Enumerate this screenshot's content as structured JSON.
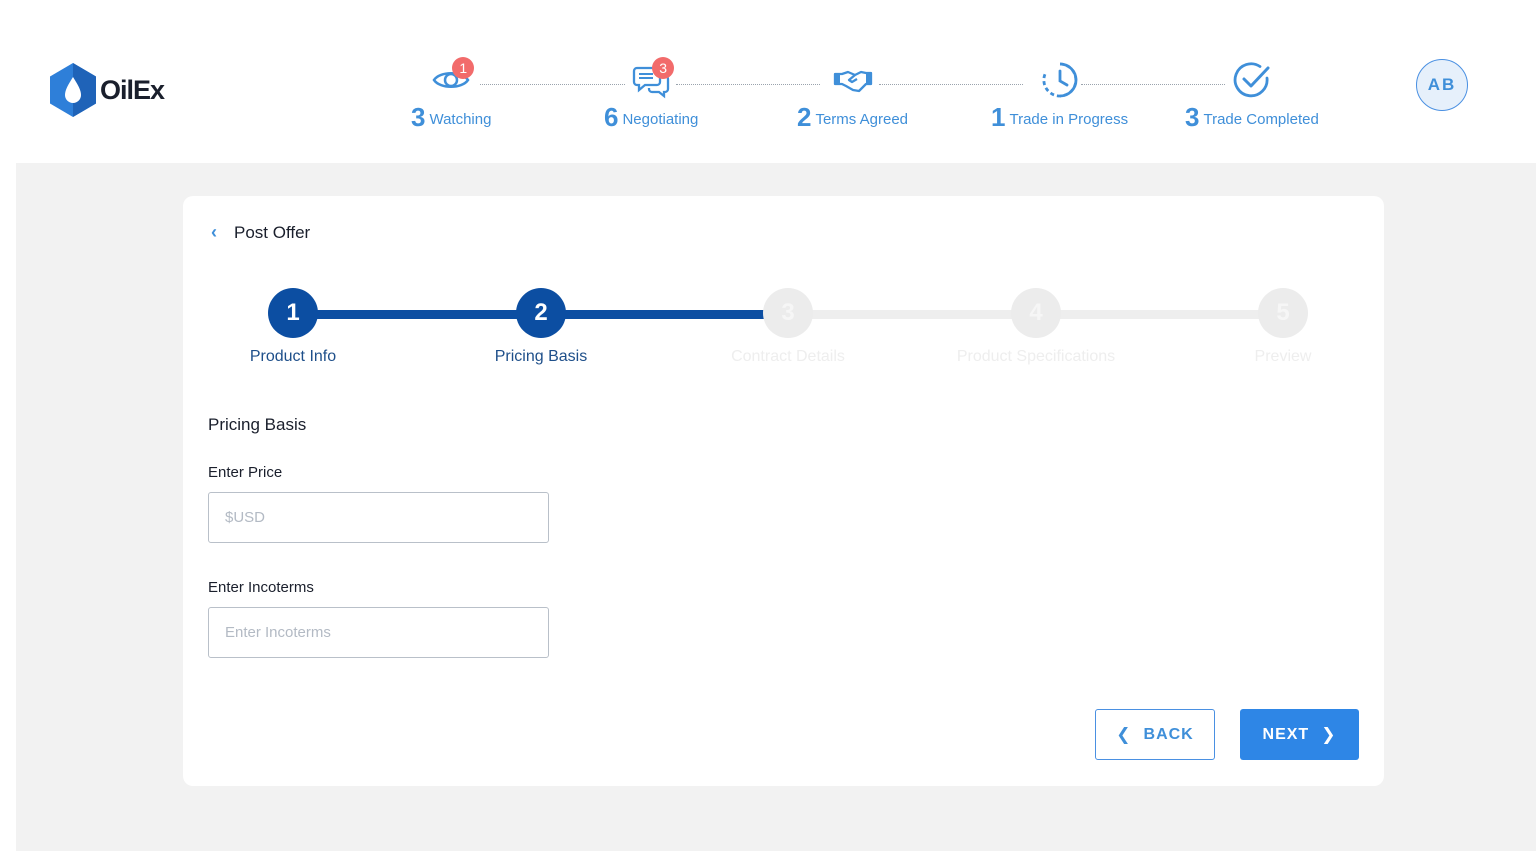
{
  "app": {
    "name": "OilEx",
    "brand_color": "#0c4ea2",
    "accent_color": "#3f8fd9"
  },
  "header": {
    "stages": [
      {
        "count": "3",
        "label": "Watching",
        "badge": "1",
        "icon": "eye-icon"
      },
      {
        "count": "6",
        "label": "Negotiating",
        "badge": "3",
        "icon": "chat-bubbles-icon"
      },
      {
        "count": "2",
        "label": "Terms Agreed",
        "badge": "",
        "icon": "handshake-icon"
      },
      {
        "count": "1",
        "label": "Trade in Progress",
        "badge": "",
        "icon": "clock-progress-icon"
      },
      {
        "count": "3",
        "label": "Trade Completed",
        "badge": "",
        "icon": "check-circle-icon"
      }
    ],
    "avatar_initials": "AB"
  },
  "page": {
    "back_label": "Post Offer",
    "stepper": [
      {
        "number": "1",
        "label": "Product Info",
        "state": "done"
      },
      {
        "number": "2",
        "label": "Pricing Basis",
        "state": "current"
      },
      {
        "number": "3",
        "label": "Contract Details",
        "state": "todo"
      },
      {
        "number": "4",
        "label": "Product Specifications",
        "state": "todo"
      },
      {
        "number": "5",
        "label": "Preview",
        "state": "todo"
      }
    ],
    "section_title": "Pricing Basis",
    "price": {
      "label": "Enter Price",
      "placeholder": "$USD",
      "value": ""
    },
    "incoterms": {
      "label": "Enter Incoterms",
      "placeholder": "Enter Incoterms",
      "value": ""
    },
    "back_button": "BACK",
    "next_button": "NEXT"
  }
}
